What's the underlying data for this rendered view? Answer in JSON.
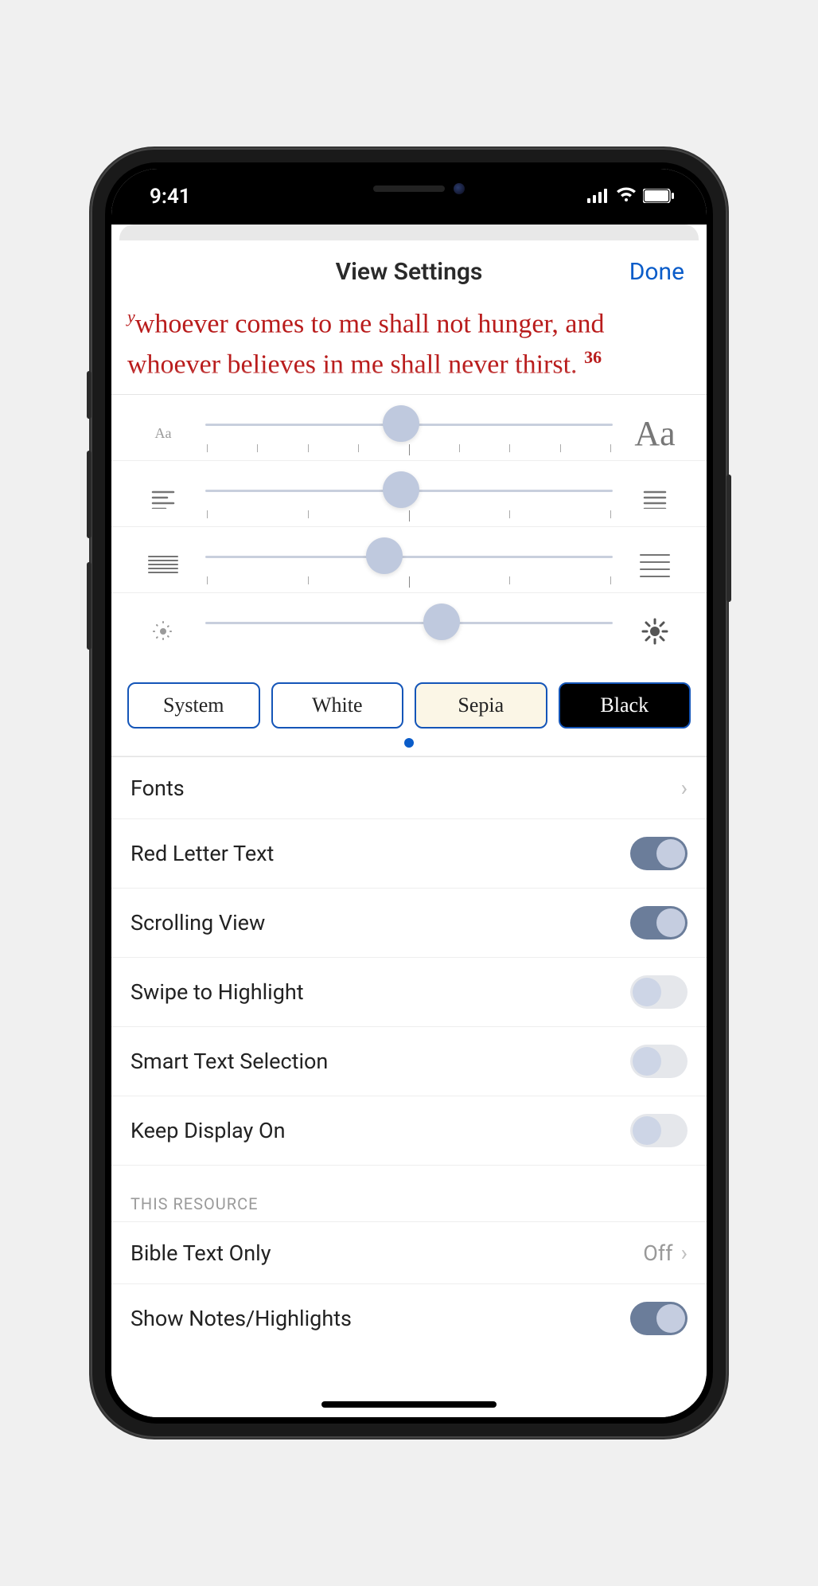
{
  "status": {
    "time": "9:41"
  },
  "modal": {
    "title": "View Settings",
    "done": "Done"
  },
  "preview": {
    "ref_letter": "y",
    "line1": "whoever comes to me shall not hunger, and",
    "line2_a": "whoever believes in me shall never thirst.",
    "verse_num": "36"
  },
  "sliders": {
    "font_size": {
      "small_label": "Aa",
      "large_label": "Aa",
      "value_pct": 48,
      "ticks": 9
    },
    "align": {
      "value_pct": 48,
      "ticks": 5
    },
    "line_spacing": {
      "value_pct": 44,
      "ticks": 5
    },
    "brightness": {
      "value_pct": 58,
      "ticks": 0
    }
  },
  "themes": {
    "system": "System",
    "white": "White",
    "sepia": "Sepia",
    "black": "Black"
  },
  "rows": {
    "fonts": "Fonts",
    "red_letter": "Red Letter Text",
    "scrolling": "Scrolling View",
    "swipe_highlight": "Swipe to Highlight",
    "smart_select": "Smart Text Selection",
    "keep_display": "Keep Display On",
    "section_resource": "THIS RESOURCE",
    "bible_text_only": "Bible Text Only",
    "bible_text_only_value": "Off",
    "show_notes": "Show Notes/Highlights"
  },
  "toggles": {
    "red_letter": true,
    "scrolling": true,
    "swipe_highlight": false,
    "smart_select": false,
    "keep_display": false,
    "show_notes": true
  }
}
